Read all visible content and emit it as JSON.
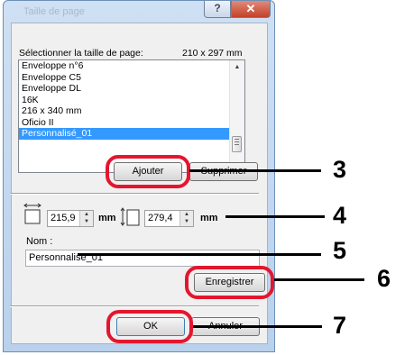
{
  "window": {
    "title": "Taille de page",
    "help_label": "?",
    "close_label": "✕"
  },
  "page_size": {
    "label": "Sélectionner la taille de page:",
    "value": "210 x 297 mm"
  },
  "list": {
    "items": [
      "Enveloppe n°6",
      "Enveloppe C5",
      "Enveloppe DL",
      "16K",
      "216 x 340 mm",
      "Oficio II",
      "Personnalisé_01"
    ],
    "selected": "Personnalisé_01"
  },
  "buttons": {
    "add": "Ajouter",
    "delete": "Supprimer",
    "save": "Enregistrer",
    "ok": "OK",
    "cancel": "Annuler"
  },
  "dimensions": {
    "width": "215,9",
    "width_unit": "mm",
    "height": "279,4",
    "height_unit": "mm"
  },
  "name": {
    "label": "Nom :",
    "value": "Personnalisé_01"
  },
  "callouts": {
    "c3": "3",
    "c4": "4",
    "c5": "5",
    "c6": "6",
    "c7": "7"
  },
  "colors": {
    "highlight": "#e4162e",
    "selection": "#3399ff"
  }
}
